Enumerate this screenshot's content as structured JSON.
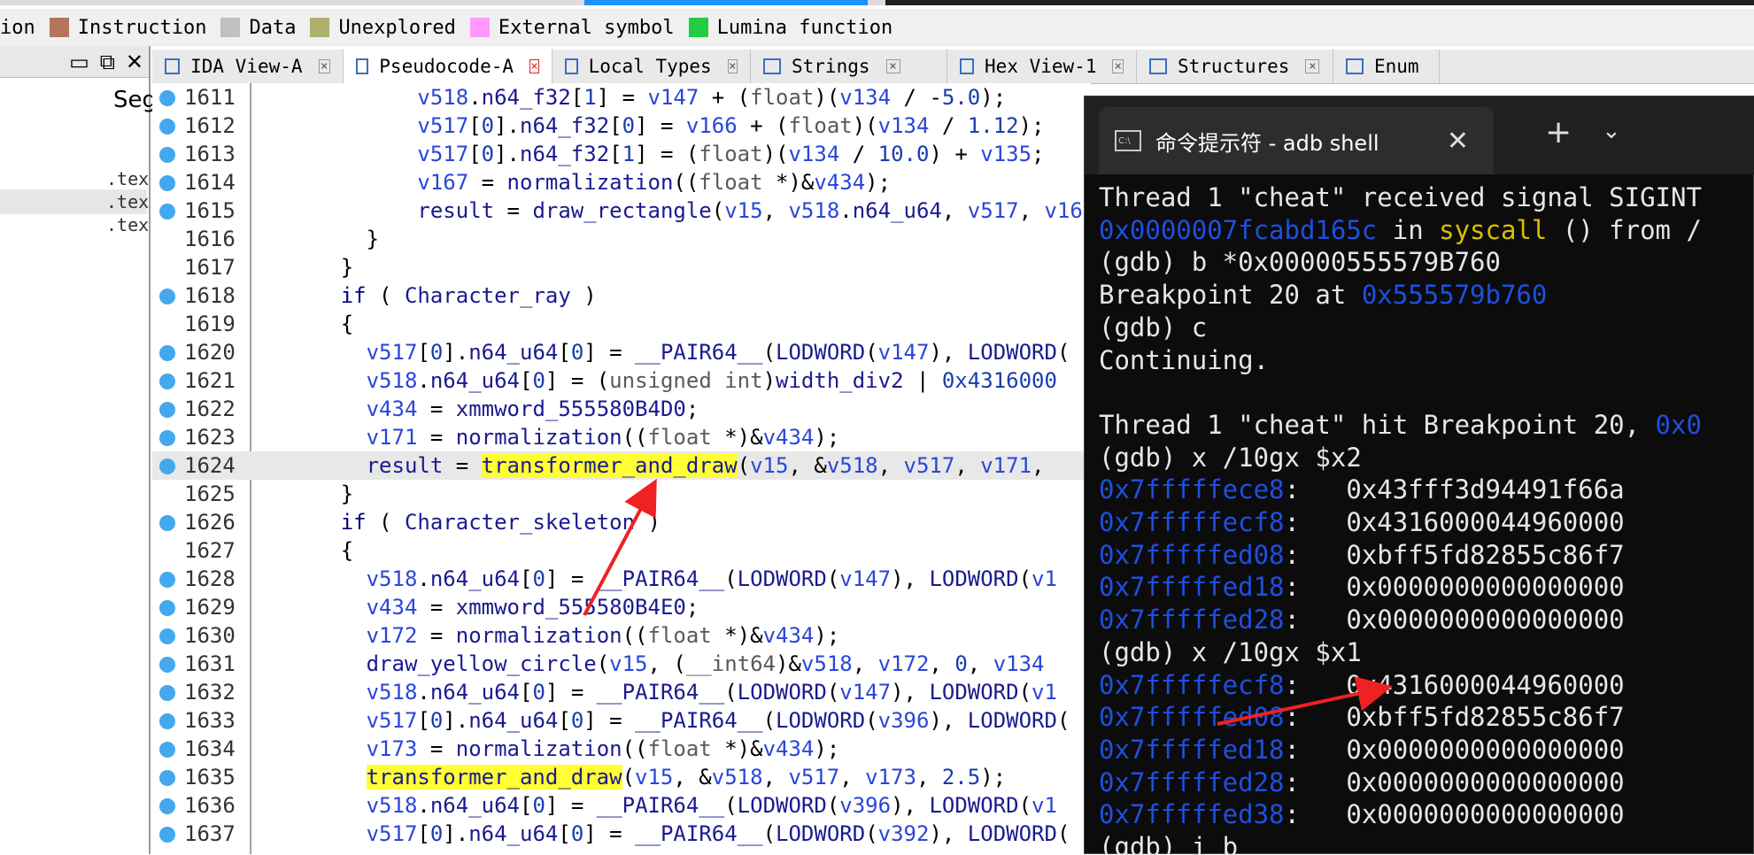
{
  "legend": [
    {
      "label": "ion",
      "color": ""
    },
    {
      "label": "Instruction",
      "color": "#b5755a"
    },
    {
      "label": "Data",
      "color": "#c0c0c0"
    },
    {
      "label": "Unexplored",
      "color": "#b0b070"
    },
    {
      "label": "External symbol",
      "color": "#ff99ff"
    },
    {
      "label": "Lumina function",
      "color": "#22cc44"
    }
  ],
  "left_panel": {
    "segment_header": "Seg",
    "rows": [
      ".tex",
      ".tex",
      ".tex"
    ]
  },
  "tabs": [
    {
      "label": "IDA View-A",
      "icon": "disasm-icon",
      "active": false
    },
    {
      "label": "Pseudocode-A",
      "icon": "pseudocode-icon",
      "active": true
    },
    {
      "label": "Local Types",
      "icon": "local-types-icon",
      "active": false
    },
    {
      "label": "Strings",
      "icon": "strings-icon",
      "active": false
    },
    {
      "label": "Hex View-1",
      "icon": "hex-icon",
      "active": false
    },
    {
      "label": "Structures",
      "icon": "structures-icon",
      "active": false
    },
    {
      "label": "Enum",
      "icon": "enums-icon",
      "active": false
    }
  ],
  "code": {
    "lines": [
      {
        "n": "1611",
        "dot": true,
        "indent": 6,
        "text": "v518.n64_f32[1] = v147 + (float)(v134 / -5.0);"
      },
      {
        "n": "1612",
        "dot": true,
        "indent": 6,
        "text": "v517[0].n64_f32[0] = v166 + (float)(v134 / 1.12);"
      },
      {
        "n": "1613",
        "dot": true,
        "indent": 6,
        "text": "v517[0].n64_f32[1] = (float)(v134 / 10.0) + v135;"
      },
      {
        "n": "1614",
        "dot": true,
        "indent": 6,
        "text": "v167 = normalization((float *)&v434);"
      },
      {
        "n": "1615",
        "dot": true,
        "indent": 6,
        "text": "result = draw_rectangle(v15, v518.n64_u64, v517, v16"
      },
      {
        "n": "1616",
        "dot": false,
        "indent": 4,
        "text": "}"
      },
      {
        "n": "1617",
        "dot": false,
        "indent": 3,
        "text": "}"
      },
      {
        "n": "1618",
        "dot": true,
        "indent": 3,
        "text": "if ( Character_ray )"
      },
      {
        "n": "1619",
        "dot": false,
        "indent": 3,
        "text": "{"
      },
      {
        "n": "1620",
        "dot": true,
        "indent": 4,
        "text": "v517[0].n64_u64[0] = __PAIR64__(LODWORD(v147), LODWORD("
      },
      {
        "n": "1621",
        "dot": true,
        "indent": 4,
        "text": "v518.n64_u64[0] = (unsigned int)width_div2 | 0x4316000"
      },
      {
        "n": "1622",
        "dot": true,
        "indent": 4,
        "text": "v434 = xmmword_555580B4D0;"
      },
      {
        "n": "1623",
        "dot": true,
        "indent": 4,
        "text": "v171 = normalization((float *)&v434);"
      },
      {
        "n": "1624",
        "dot": true,
        "indent": 4,
        "text": "result = transformer_and_draw(v15, &v518, v517, v171,",
        "hl": true,
        "mark": "transformer_and_draw"
      },
      {
        "n": "1625",
        "dot": false,
        "indent": 3,
        "text": "}"
      },
      {
        "n": "1626",
        "dot": true,
        "indent": 3,
        "text": "if ( Character_skeleton )"
      },
      {
        "n": "1627",
        "dot": false,
        "indent": 3,
        "text": "{"
      },
      {
        "n": "1628",
        "dot": true,
        "indent": 4,
        "text": "v518.n64_u64[0] = __PAIR64__(LODWORD(v147), LODWORD(v1"
      },
      {
        "n": "1629",
        "dot": true,
        "indent": 4,
        "text": "v434 = xmmword_555580B4E0;"
      },
      {
        "n": "1630",
        "dot": true,
        "indent": 4,
        "text": "v172 = normalization((float *)&v434);"
      },
      {
        "n": "1631",
        "dot": true,
        "indent": 4,
        "text": "draw_yellow_circle(v15, (__int64)&v518, v172, 0, v134"
      },
      {
        "n": "1632",
        "dot": true,
        "indent": 4,
        "text": "v518.n64_u64[0] = __PAIR64__(LODWORD(v147), LODWORD(v1"
      },
      {
        "n": "1633",
        "dot": true,
        "indent": 4,
        "text": "v517[0].n64_u64[0] = __PAIR64__(LODWORD(v396), LODWORD("
      },
      {
        "n": "1634",
        "dot": true,
        "indent": 4,
        "text": "v173 = normalization((float *)&v434);"
      },
      {
        "n": "1635",
        "dot": true,
        "indent": 4,
        "text": "transformer_and_draw(v15, &v518, v517, v173, 2.5);",
        "mark": "transformer_and_draw"
      },
      {
        "n": "1636",
        "dot": true,
        "indent": 4,
        "text": "v518.n64_u64[0] = __PAIR64__(LODWORD(v396), LODWORD(v1"
      },
      {
        "n": "1637",
        "dot": true,
        "indent": 4,
        "text": "v517[0].n64_u64[0] = __PAIR64__(LODWORD(v392), LODWORD("
      }
    ]
  },
  "terminal": {
    "title": "命令提示符 - adb  shell",
    "lines": [
      [
        {
          "t": "Thread 1 \"cheat\" received signal SIGINT",
          "c": "w"
        }
      ],
      [
        {
          "t": "0x0000007fcabd165c",
          "c": "b"
        },
        {
          "t": " in ",
          "c": "w"
        },
        {
          "t": "syscall",
          "c": "y"
        },
        {
          "t": " () from /",
          "c": "w"
        }
      ],
      [
        {
          "t": "(gdb) b *0x00000555579B760",
          "c": "w"
        }
      ],
      [
        {
          "t": "Breakpoint 20 at ",
          "c": "w"
        },
        {
          "t": "0x555579b760",
          "c": "b"
        }
      ],
      [
        {
          "t": "(gdb) c",
          "c": "w"
        }
      ],
      [
        {
          "t": "Continuing.",
          "c": "w"
        }
      ],
      [
        {
          "t": "",
          "c": "w"
        }
      ],
      [
        {
          "t": "Thread 1 \"cheat\" hit Breakpoint 20, ",
          "c": "w"
        },
        {
          "t": "0x0",
          "c": "b"
        }
      ],
      [
        {
          "t": "(gdb) x /10gx $x2",
          "c": "w"
        }
      ],
      [
        {
          "t": "0x7fffffece8",
          "c": "b"
        },
        {
          "t": ":   0x43fff3d94491f66a",
          "c": "w"
        }
      ],
      [
        {
          "t": "0x7fffffecf8",
          "c": "b"
        },
        {
          "t": ":   0x4316000044960000",
          "c": "w"
        }
      ],
      [
        {
          "t": "0x7fffffed08",
          "c": "b"
        },
        {
          "t": ":   0xbff5fd82855c86f7",
          "c": "w"
        }
      ],
      [
        {
          "t": "0x7fffffed18",
          "c": "b"
        },
        {
          "t": ":   0x0000000000000000",
          "c": "w"
        }
      ],
      [
        {
          "t": "0x7fffffed28",
          "c": "b"
        },
        {
          "t": ":   0x0000000000000000",
          "c": "w"
        }
      ],
      [
        {
          "t": "(gdb) x /10gx $x1",
          "c": "w"
        }
      ],
      [
        {
          "t": "0x7fffffecf8",
          "c": "b"
        },
        {
          "t": ":   0x4316000044960000",
          "c": "w"
        }
      ],
      [
        {
          "t": "0x7fffffed08",
          "c": "b"
        },
        {
          "t": ":   0xbff5fd82855c86f7",
          "c": "w"
        }
      ],
      [
        {
          "t": "0x7fffffed18",
          "c": "b"
        },
        {
          "t": ":   0x0000000000000000",
          "c": "w"
        }
      ],
      [
        {
          "t": "0x7fffffed28",
          "c": "b"
        },
        {
          "t": ":   0x0000000000000000",
          "c": "w"
        }
      ],
      [
        {
          "t": "0x7fffffed38",
          "c": "b"
        },
        {
          "t": ":   0x0000000000000000",
          "c": "w"
        }
      ],
      [
        {
          "t": "(gdb) i b",
          "c": "w"
        }
      ]
    ]
  },
  "colors": {
    "code_default": "#1a3cb0",
    "keyword": "#1a3cb0",
    "var": "#1a3cb0",
    "punct": "#000000",
    "highlight": "#ffff33",
    "term_white": "#e6e6e6",
    "term_blue": "#1f4fe0",
    "term_yellow": "#d7c000",
    "arrow": "#ee2222"
  }
}
